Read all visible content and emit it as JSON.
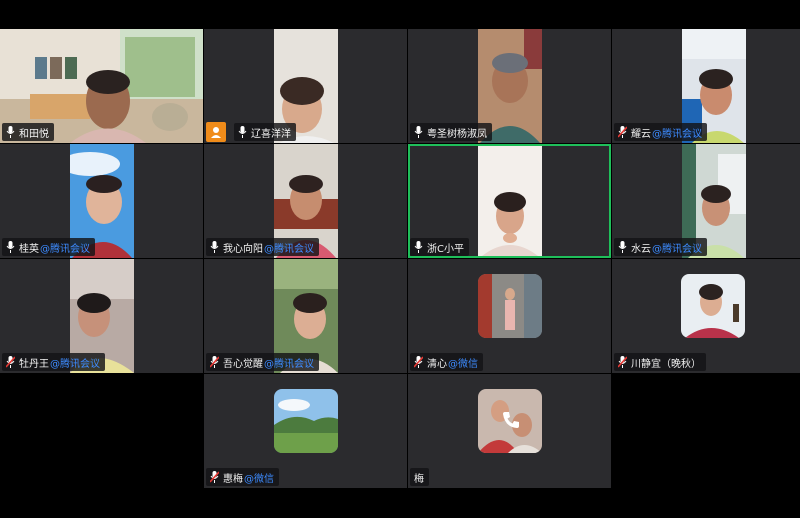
{
  "participants": [
    {
      "name": "和田悦",
      "suffix": "",
      "muted": false,
      "active": false
    },
    {
      "name": "辽喜洋洋",
      "suffix": "",
      "muted": false,
      "active": false
    },
    {
      "name": "粤圣树杨淑凤",
      "suffix": "",
      "muted": false,
      "active": false
    },
    {
      "name": "耀云",
      "suffix": "@腾讯会议",
      "muted": true,
      "active": false
    },
    {
      "name": "桂英",
      "suffix": "@腾讯会议",
      "muted": false,
      "active": false
    },
    {
      "name": "我心向阳",
      "suffix": "@腾讯会议",
      "muted": false,
      "active": false
    },
    {
      "name": "浙C小平",
      "suffix": "",
      "muted": false,
      "active": true
    },
    {
      "name": "水云",
      "suffix": "@腾讯会议",
      "muted": false,
      "active": false
    },
    {
      "name": "牡丹王",
      "suffix": "@腾讯会议",
      "muted": true,
      "active": false
    },
    {
      "name": "吾心觉醒",
      "suffix": "@腾讯会议",
      "muted": true,
      "active": false
    },
    {
      "name": "清心",
      "suffix": "@微信",
      "muted": true,
      "active": false
    },
    {
      "name": "川静宜（晚秋）",
      "suffix": "",
      "muted": true,
      "active": false
    },
    {
      "name": "惠梅",
      "suffix": "@微信",
      "muted": true,
      "active": false
    },
    {
      "name": "梅",
      "suffix": "",
      "muted": false,
      "active": false
    }
  ],
  "icons": {
    "mic": "microphone-icon",
    "mic_muted": "microphone-muted-icon",
    "avatar": "user-avatar-icon",
    "phone": "phone-icon"
  },
  "colors": {
    "tile_bg": "#2b2b2e",
    "active_border": "#1fbf5a",
    "suffix": "#3d8bff",
    "muted_slash": "#e53935",
    "avatar_badge": "#f08c1a"
  }
}
